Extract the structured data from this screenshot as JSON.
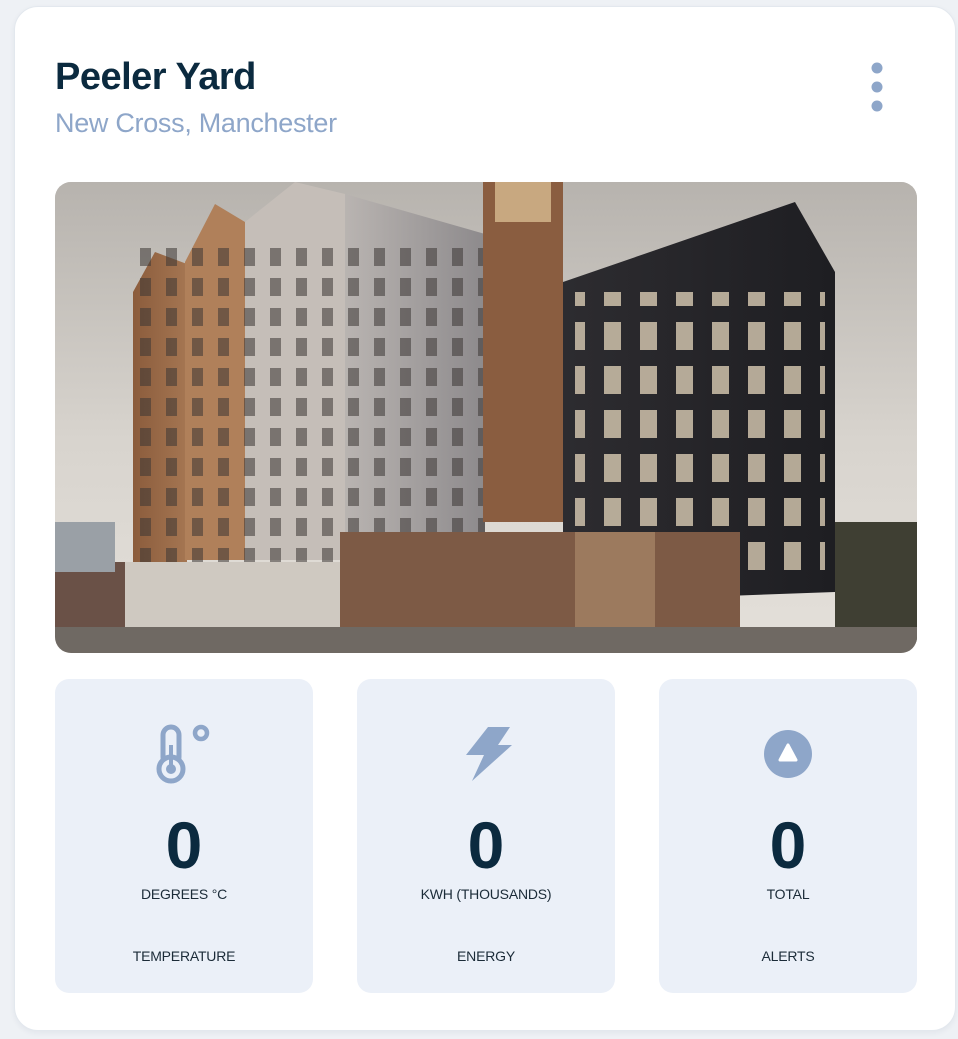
{
  "property": {
    "name": "Peeler Yard",
    "location": "New Cross, Manchester"
  },
  "menu": {
    "icon": "vertical-dots-icon"
  },
  "colors": {
    "title": "#0b2a3f",
    "subtitle": "#8ea6c9",
    "icon": "#8ea6c9",
    "tile_background": "#ebf0f8"
  },
  "stats": [
    {
      "icon": "thermometer-icon",
      "value": "0",
      "unit": "DEGREES °C",
      "label": "TEMPERATURE"
    },
    {
      "icon": "lightning-bolt-icon",
      "value": "0",
      "unit": "KWH (THOUSANDS)",
      "label": "ENERGY"
    },
    {
      "icon": "alert-triangle-icon",
      "value": "0",
      "unit": "TOTAL",
      "label": "ALERTS"
    }
  ]
}
